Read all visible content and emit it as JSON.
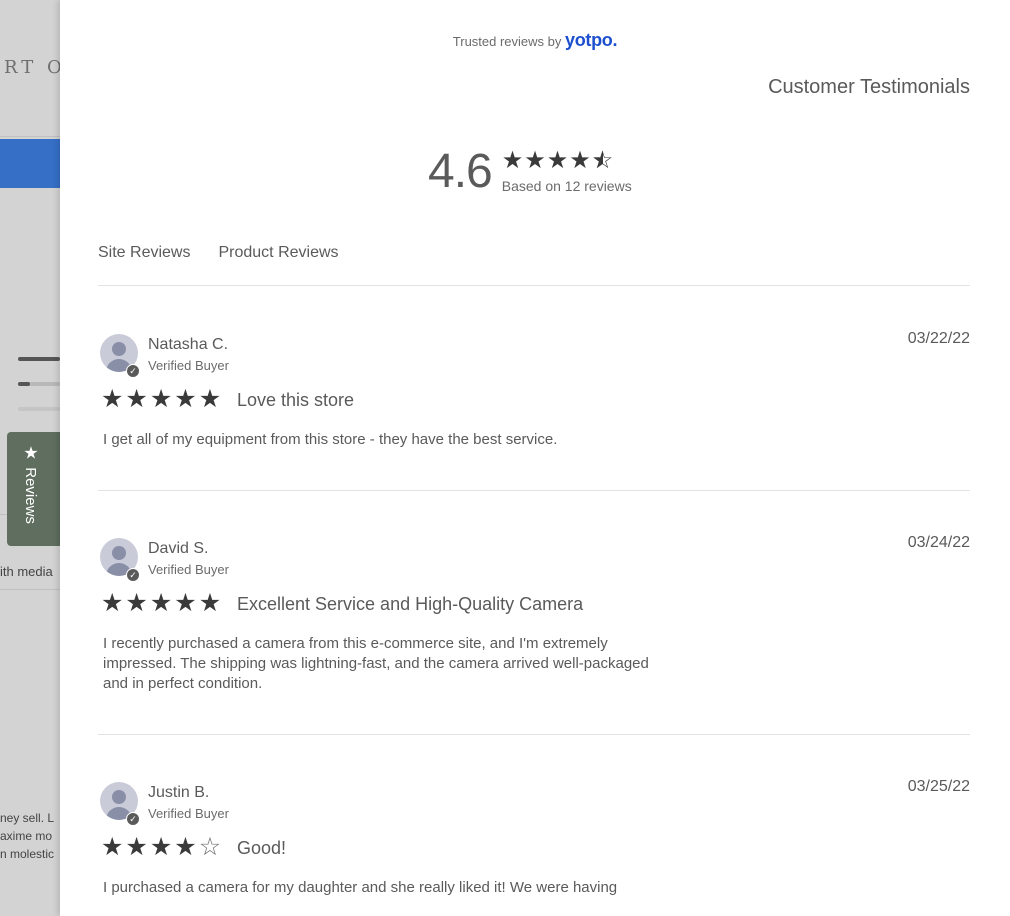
{
  "background": {
    "logo_text": "RT OF",
    "media_text": "ith media",
    "text_lines": [
      "ney sell. L",
      "axime mo",
      "n molestic"
    ],
    "reviews_tab_label": "Reviews"
  },
  "header": {
    "trusted_text": "Trusted reviews by",
    "brand": "yotpo.",
    "title": "Customer Testimonials"
  },
  "summary": {
    "average": "4.6",
    "rating_value": 4.6,
    "based_on": "Based on 12 reviews"
  },
  "tabs": [
    {
      "label": "Site Reviews"
    },
    {
      "label": "Product Reviews"
    }
  ],
  "reviews": [
    {
      "name": "Natasha C.",
      "badge": "Verified Buyer",
      "date": "03/22/22",
      "rating": 5,
      "title": "Love this store",
      "body": "I get all of my equipment from this store - they have the best service."
    },
    {
      "name": "David S.",
      "badge": "Verified Buyer",
      "date": "03/24/22",
      "rating": 5,
      "title": "Excellent Service and High-Quality Camera",
      "body": "I recently purchased a camera from this e-commerce site, and I'm extremely impressed. The shipping was lightning-fast, and the camera arrived well-packaged and in perfect condition."
    },
    {
      "name": "Justin B.",
      "badge": "Verified Buyer",
      "date": "03/25/22",
      "rating": 4,
      "title": "Good!",
      "body": "I purchased a camera for my daughter and she really liked it! We were having"
    }
  ],
  "colors": {
    "brand": "#1c4fcf",
    "reviews_tab": "#5f6e5f",
    "background_accent": "#356fc6"
  }
}
